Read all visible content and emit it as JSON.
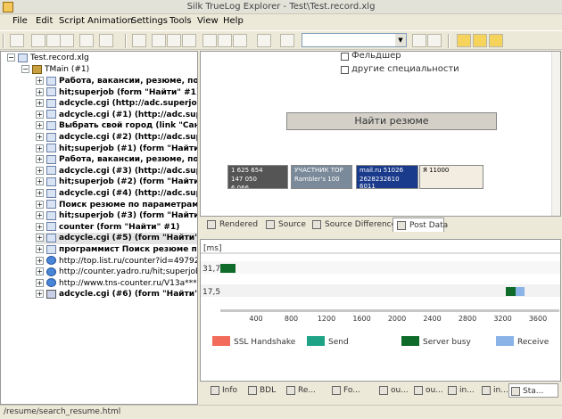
{
  "window": {
    "title": "Silk TrueLog Explorer - Test\\Test.record.xlg"
  },
  "menu": [
    "File",
    "Edit",
    "Script",
    "Animation",
    "Settings",
    "Tools",
    "View",
    "Help"
  ],
  "toolbar": {
    "icons": [
      "new-icon",
      "open-icon",
      "save-icon",
      "view-icon",
      "compare-icon",
      "settings-icon",
      "hand-icon",
      "zoom-icon",
      "zoom-out-icon",
      "page-icon",
      "page-back-icon",
      "page-forward-icon",
      "page-last-icon",
      "book-icon",
      "binoculars-icon",
      "find-next-icon",
      "find-prev-icon",
      "layout-icon",
      "export-icon",
      "report-icon"
    ],
    "find_value": ""
  },
  "tree": {
    "root": "Test.record.xlg",
    "main": "TMain (#1)",
    "items": [
      {
        "label": "Работа, вакансии, резюме, поиск",
        "bold": true,
        "icon": "doc"
      },
      {
        "label": "hit;superjob (form \"Найти\" #1)",
        "bold": true,
        "icon": "doc"
      },
      {
        "label": "adcycle.cgi (http://adc.superjob.ru",
        "bold": true,
        "icon": "doc"
      },
      {
        "label": "adcycle.cgi (#1) (http://adc.super",
        "bold": true,
        "icon": "doc"
      },
      {
        "label": "Выбрать свой город (link \"Санкт",
        "bold": true,
        "icon": "doc"
      },
      {
        "label": "adcycle.cgi (#2) (http://adc.super",
        "bold": true,
        "icon": "doc"
      },
      {
        "label": "hit;superjob (#1) (form \"Найти\" #",
        "bold": true,
        "icon": "doc"
      },
      {
        "label": "Работа, вакансии, резюме, поиск",
        "bold": true,
        "icon": "doc"
      },
      {
        "label": "adcycle.cgi (#3) (http://adc.super",
        "bold": true,
        "icon": "doc"
      },
      {
        "label": "hit;superjob (#2) (form \"Найти\" #",
        "bold": true,
        "icon": "doc"
      },
      {
        "label": "adcycle.cgi (#4) (http://adc.super",
        "bold": true,
        "icon": "doc"
      },
      {
        "label": "Поиск резюме по параметрам (lin",
        "bold": true,
        "icon": "doc"
      },
      {
        "label": "hit;superjob (#3) (form \"Найти\" #",
        "bold": true,
        "icon": "doc"
      },
      {
        "label": "counter (form \"Найти\" #1)",
        "bold": true,
        "icon": "doc"
      },
      {
        "label": "adcycle.cgi (#5) (form \"Найти\" #1",
        "bold": true,
        "icon": "doc",
        "selected": true
      },
      {
        "label": "программист Поиск резюме по п",
        "bold": true,
        "icon": "doc"
      },
      {
        "label": "http://top.list.ru/counter?id=49792;js=",
        "bold": false,
        "icon": "globe"
      },
      {
        "label": "http://counter.yadro.ru/hit;superjob?rh",
        "bold": false,
        "icon": "globe"
      },
      {
        "label": "http://www.tns-counter.ru/V13a***R%",
        "bold": false,
        "icon": "globe"
      },
      {
        "label": "adcycle.cgi (#6) (form \"Найти\" #1",
        "bold": true,
        "icon": "doc2"
      }
    ]
  },
  "browser": {
    "checkboxes": [
      "Фельдшер",
      "другие специальности"
    ],
    "find_button": "Найти резюме",
    "banners": [
      {
        "lines": [
          "1 625 654",
          "147 050",
          "6 066"
        ],
        "bg": "#555555",
        "color": "#ffffff"
      },
      {
        "lines": [
          "УЧАСТНИК TOP",
          "Rambler's 100"
        ],
        "bg": "#7a8a9a",
        "color": "#ffffff"
      },
      {
        "lines": [
          "mail.ru 51026",
          "2628232610 6011"
        ],
        "bg": "#1a3a8c",
        "color": "#ffffff"
      },
      {
        "lines": [
          "Я 11000"
        ],
        "bg": "#f3ede1",
        "color": "#000000"
      }
    ]
  },
  "view_tabs": [
    "Rendered",
    "Source",
    "Source Differences",
    "Post Data"
  ],
  "timing": {
    "unit_label": "[ms]",
    "row_labels": [
      "31,7",
      "17,5"
    ],
    "axis_ticks": [
      "400",
      "800",
      "1200",
      "1600",
      "2000",
      "2400",
      "2800",
      "3200",
      "3600"
    ],
    "legend": [
      {
        "label": "SSL Handshake",
        "color": "#f26b5b"
      },
      {
        "label": "Send",
        "color": "#1fa387"
      },
      {
        "label": "Server busy",
        "color": "#0f6b2a"
      },
      {
        "label": "Receive",
        "color": "#8ab4e8"
      }
    ]
  },
  "bottom_tabs": [
    "Info",
    "BDL",
    "Re...",
    "Fo...",
    "ou...",
    "ou...",
    "in...",
    "in...",
    "Sta..."
  ],
  "status": {
    "text": "/resume/search_resume.html"
  }
}
